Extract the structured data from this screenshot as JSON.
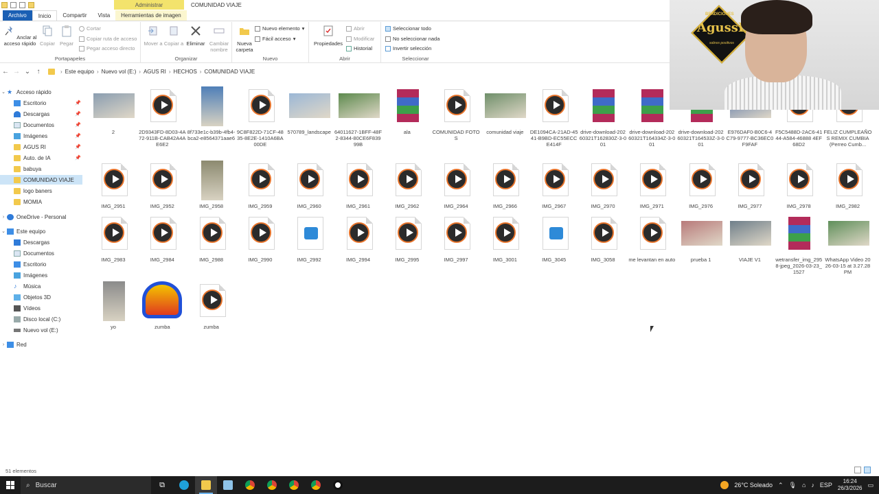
{
  "window": {
    "title": "COMUNIDAD VIAJE",
    "contextual_tab": "Administrar"
  },
  "ribbon_tabs": [
    "Archivo",
    "Inicio",
    "Compartir",
    "Vista",
    "Herramientas de imagen"
  ],
  "ribbon": {
    "portapapeles": {
      "label": "Portapapeles",
      "anclar": "Anclar al acceso rápido",
      "copiar": "Copiar",
      "pegar": "Pegar",
      "cortar": "Cortar",
      "copiar_ruta": "Copiar ruta de acceso",
      "pegar_acceso": "Pegar acceso directo"
    },
    "organizar": {
      "label": "Organizar",
      "mover": "Mover a",
      "copiar": "Copiar a",
      "eliminar": "Eliminar",
      "cambiar": "Cambiar nombre"
    },
    "nuevo": {
      "label": "Nuevo",
      "nueva_carpeta": "Nueva carpeta",
      "nuevo_elemento": "Nuevo elemento",
      "facil_acceso": "Fácil acceso"
    },
    "abrir": {
      "label": "Abrir",
      "propiedades": "Propiedades",
      "abrir": "Abrir",
      "modificar": "Modificar",
      "historial": "Historial"
    },
    "seleccionar": {
      "label": "Seleccionar",
      "todo": "Seleccionar todo",
      "nada": "No seleccionar nada",
      "invertir": "Invertir selección"
    }
  },
  "breadcrumb": [
    "Este equipo",
    "Nuevo vol (E:)",
    "AGUS RI",
    "HECHOS",
    "COMUNIDAD VIAJE"
  ],
  "nav": {
    "quick_access": "Acceso rápido",
    "quick_items": [
      "Escritorio",
      "Descargas",
      "Documentos",
      "Imágenes",
      "AGUS RI",
      "Auto. de IA",
      "babuya",
      "COMUNIDAD VIAJE",
      "logo baners",
      "MOMIA"
    ],
    "onedrive": "OneDrive - Personal",
    "this_pc": "Este equipo",
    "pc_items": [
      "Descargas",
      "Documentos",
      "Escritorio",
      "Imágenes",
      "Música",
      "Objetos 3D",
      "Vídeos",
      "Disco local (C:)",
      "Nuevo vol (E:)"
    ],
    "network": "Red"
  },
  "files": [
    {
      "name": "2",
      "type": "photo",
      "color": "#8a9db0"
    },
    {
      "name": "2D9343FD-8D03-4A72-911B-CAB42A4AE6E2",
      "type": "video"
    },
    {
      "name": "8f733e1c-b39b-4fb4-bca2-e8564371aae6",
      "type": "photo-tall",
      "color": "#4f7fb8"
    },
    {
      "name": "9C8F822D-71CF-4835-8E2E-1410A6BA00DE",
      "type": "video"
    },
    {
      "name": "570789_landscape",
      "type": "photo",
      "color": "#9bb7d6"
    },
    {
      "name": "64011627-1BFF-48F2-8344-80CE6F83999B",
      "type": "photo",
      "color": "#5d8a4e"
    },
    {
      "name": "ala",
      "type": "rar"
    },
    {
      "name": "COMUNIDAD FOTOS",
      "type": "video"
    },
    {
      "name": "comunidad viaje",
      "type": "photo",
      "color": "#6f8f6a"
    },
    {
      "name": "DE1094CA-21AD-4541-B9BD-EC55ECCE414F",
      "type": "video"
    },
    {
      "name": "drive-download-20260321T162830Z-3-001",
      "type": "rar"
    },
    {
      "name": "drive-download-20260321T164334Z-3-001",
      "type": "rar"
    },
    {
      "name": "drive-download-20260321T164533Z-3-001",
      "type": "rar"
    },
    {
      "name": "E976DAF0-B0C6-4C79-9777-BC36EC0F9FAF",
      "type": "photo",
      "color": "#5a77a8"
    },
    {
      "name": "F5C5488D-2AC6-4144-A584-46888 4EF68D2",
      "type": "video"
    },
    {
      "name": "FELIZ CUMPLEAÑOS REMIX CUMBIA (Perreo Cumb...",
      "type": "video"
    },
    {
      "name": "IMG_2951",
      "type": "video"
    },
    {
      "name": "IMG_2952",
      "type": "video"
    },
    {
      "name": "IMG_2958",
      "type": "photo-tall",
      "color": "#8c8a70"
    },
    {
      "name": "IMG_2959",
      "type": "video"
    },
    {
      "name": "IMG_2960",
      "type": "video"
    },
    {
      "name": "IMG_2961",
      "type": "video"
    },
    {
      "name": "IMG_2962",
      "type": "video"
    },
    {
      "name": "IMG_2964",
      "type": "video"
    },
    {
      "name": "IMG_2966",
      "type": "video"
    },
    {
      "name": "IMG_2967",
      "type": "video"
    },
    {
      "name": "IMG_2970",
      "type": "video"
    },
    {
      "name": "IMG_2971",
      "type": "video"
    },
    {
      "name": "IMG_2976",
      "type": "video"
    },
    {
      "name": "IMG_2977",
      "type": "video"
    },
    {
      "name": "IMG_2978",
      "type": "video"
    },
    {
      "name": "IMG_2982",
      "type": "video"
    },
    {
      "name": "IMG_2983",
      "type": "video"
    },
    {
      "name": "IMG_2984",
      "type": "video"
    },
    {
      "name": "IMG_2988",
      "type": "video"
    },
    {
      "name": "IMG_2990",
      "type": "video"
    },
    {
      "name": "IMG_2992",
      "type": "imagedoc"
    },
    {
      "name": "IMG_2994",
      "type": "video"
    },
    {
      "name": "IMG_2995",
      "type": "video"
    },
    {
      "name": "IMG_2997",
      "type": "video"
    },
    {
      "name": "IMG_3001",
      "type": "video"
    },
    {
      "name": "IMG_3045",
      "type": "imagedoc"
    },
    {
      "name": "IMG_3058",
      "type": "video"
    },
    {
      "name": "me levantan en auto",
      "type": "video"
    },
    {
      "name": "prueba 1",
      "type": "photo",
      "color": "#b87a7a"
    },
    {
      "name": "VIAJE V1",
      "type": "photo",
      "color": "#6f7f8a"
    },
    {
      "name": "wetransfer_img_2958-jpeg_2026-03-23_1527",
      "type": "rar"
    },
    {
      "name": "WhatsApp Video 2026-03-15 at 3.27.28 PM",
      "type": "photo",
      "color": "#5f8f5a"
    },
    {
      "name": "yo",
      "type": "photo-tall",
      "color": "#8b8b8b"
    },
    {
      "name": "zumba",
      "type": "audio"
    },
    {
      "name": "zumba",
      "type": "video"
    }
  ],
  "status": "51 elementos",
  "taskbar": {
    "search": "Buscar",
    "weather": "26°C  Soleado",
    "lang": "ESP",
    "time": "16:24",
    "date": "26/3/2026"
  },
  "webcam": {
    "badge_name": "AgussR",
    "badge_top": "BENDICIONES",
    "badge_bottom": "sobres positivos"
  },
  "colors": {
    "accent": "#1a5fb4",
    "selected": "#cce4f7",
    "ctx_tab": "#f3e36c"
  }
}
